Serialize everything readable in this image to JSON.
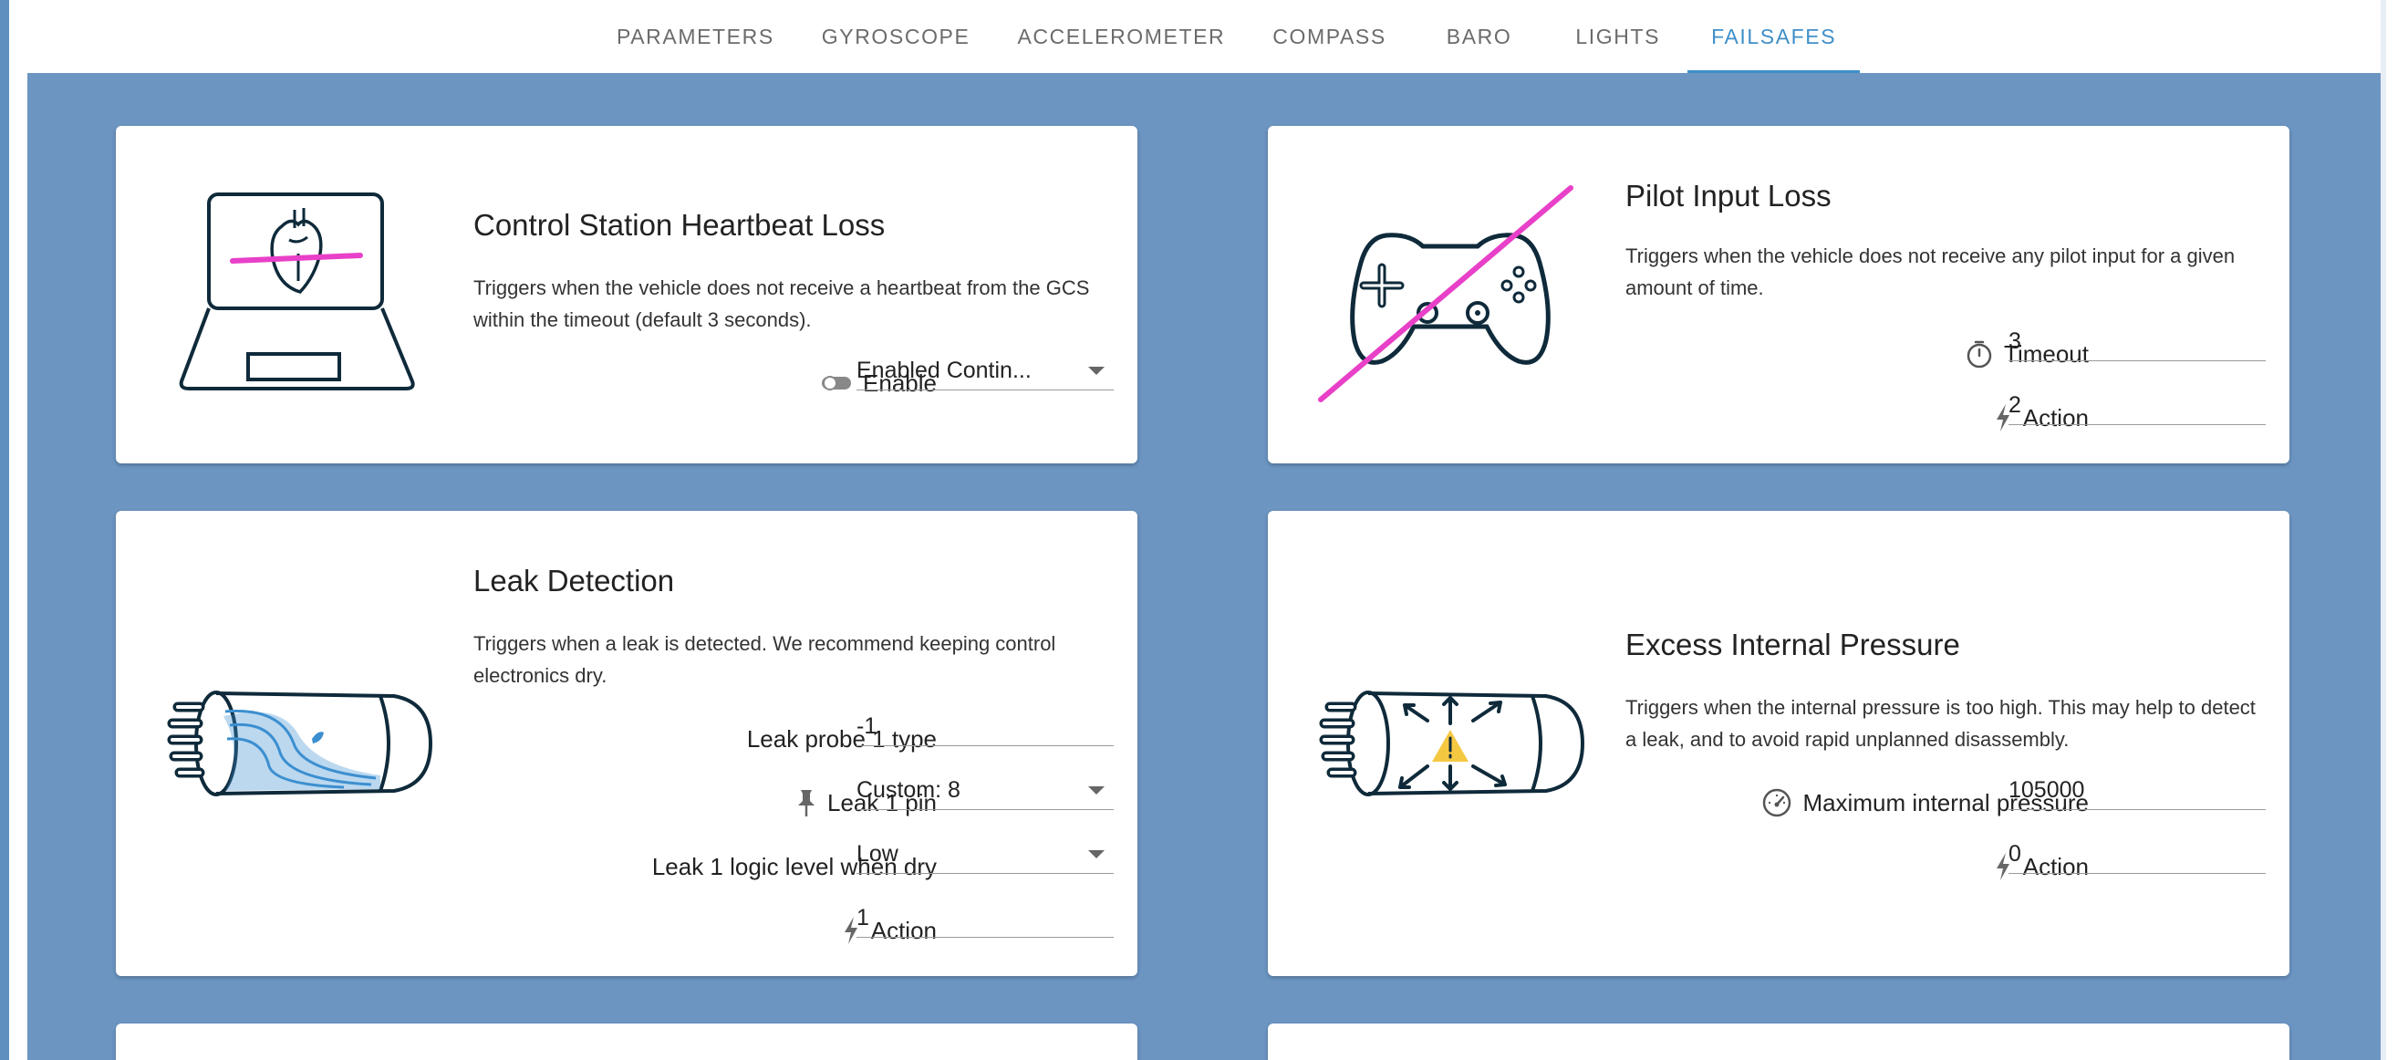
{
  "tabs": [
    {
      "label": "PARAMETERS"
    },
    {
      "label": "GYROSCOPE"
    },
    {
      "label": "ACCELEROMETER"
    },
    {
      "label": "COMPASS"
    },
    {
      "label": "BARO"
    },
    {
      "label": "LIGHTS"
    },
    {
      "label": "FAILSAFES",
      "active": true
    }
  ],
  "colors": {
    "accent": "#3f8fc9",
    "background": "#6c95c2",
    "strike": "#e840c8",
    "water": "#3c8fd0",
    "warning": "#f5c842",
    "ink": "#0f2a3a"
  },
  "cards": {
    "heartbeat": {
      "title": "Control Station Heartbeat Loss",
      "description": "Triggers when the vehicle does not receive a heartbeat from the GCS within the timeout (default 3 seconds).",
      "enable_icon": "toggle-icon",
      "enable_label": "Enable",
      "enable_value": "Enabled Contin..."
    },
    "pilot_input": {
      "title": "Pilot Input Loss",
      "description": "Triggers when the vehicle does not receive any pilot input for a given amount of time.",
      "timeout_icon": "stopwatch-icon",
      "timeout_label": "Timeout",
      "timeout_value": "3",
      "action_icon": "bolt-icon",
      "action_label": "Action",
      "action_value": "2"
    },
    "leak": {
      "title": "Leak Detection",
      "description": "Triggers when a leak is detected. We recommend keeping control electronics dry.",
      "probe_label": "Leak probe 1 type",
      "probe_value": "-1",
      "pin_icon": "pin-icon",
      "pin_label": "Leak 1 pin",
      "pin_value": "Custom: 8",
      "logic_label": "Leak 1 logic level when dry",
      "logic_value": "Low",
      "action_icon": "bolt-icon",
      "action_label": "Action",
      "action_value": "1"
    },
    "pressure": {
      "title": "Excess Internal Pressure",
      "description": "Triggers when the internal pressure is too high. This may help to detect a leak, and to avoid rapid unplanned disassembly.",
      "max_icon": "gauge-icon",
      "max_label": "Maximum internal pressure",
      "max_value": "105000",
      "action_icon": "bolt-icon",
      "action_label": "Action",
      "action_value": "0"
    }
  }
}
